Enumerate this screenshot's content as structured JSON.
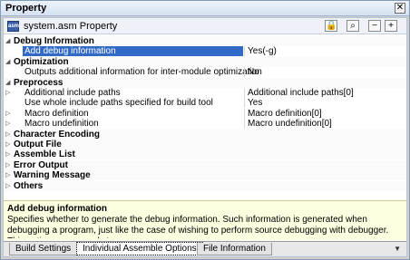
{
  "window": {
    "title": "Property"
  },
  "toolbar": {
    "label": "system.asm Property",
    "file_icon_text": "asm"
  },
  "rows": [
    {
      "type": "cat",
      "expanded": true,
      "name": "Debug Information"
    },
    {
      "type": "prop",
      "name": "Add debug information",
      "value": "Yes(-g)",
      "selected": true
    },
    {
      "type": "cat",
      "expanded": true,
      "name": "Optimization"
    },
    {
      "type": "prop",
      "name": "Outputs additional information for inter-module optimization",
      "value": "No"
    },
    {
      "type": "cat",
      "expanded": true,
      "name": "Preprocess"
    },
    {
      "type": "prop",
      "expandable": true,
      "name": "Additional include paths",
      "value": "Additional include paths[0]"
    },
    {
      "type": "prop",
      "name": "Use whole include paths specified for build tool",
      "value": "Yes"
    },
    {
      "type": "prop",
      "expandable": true,
      "name": "Macro definition",
      "value": "Macro definition[0]"
    },
    {
      "type": "prop",
      "expandable": true,
      "name": "Macro undefinition",
      "value": "Macro undefinition[0]"
    },
    {
      "type": "cat",
      "expanded": false,
      "name": "Character Encoding"
    },
    {
      "type": "cat",
      "expanded": false,
      "name": "Output File"
    },
    {
      "type": "cat",
      "expanded": false,
      "name": "Assemble List"
    },
    {
      "type": "cat",
      "expanded": false,
      "name": "Error Output"
    },
    {
      "type": "cat",
      "expanded": false,
      "name": "Warning Message"
    },
    {
      "type": "cat",
      "expanded": false,
      "name": "Others"
    }
  ],
  "description": {
    "title": "Add debug information",
    "text": "Specifies whether to generate the debug information. Such information is generated when debugging a program, just like the case of wishing to perform source debugging with debugger. This option corresponds to.."
  },
  "tabs": [
    {
      "label": "Build Settings",
      "active": false
    },
    {
      "label": "Individual Assemble Options",
      "active": true
    },
    {
      "label": "File Information",
      "active": false
    }
  ]
}
